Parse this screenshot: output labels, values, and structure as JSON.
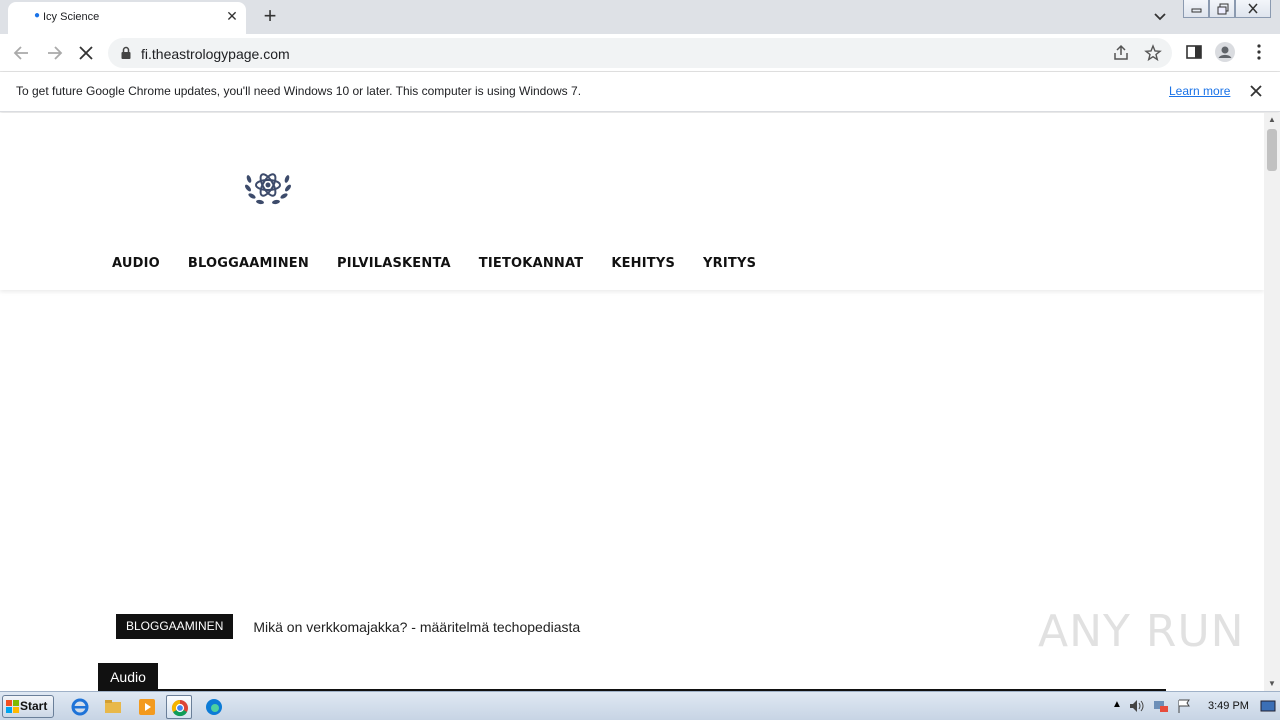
{
  "browser": {
    "tab_title": "Icy Science",
    "url": "fi.theastrologypage.com"
  },
  "infobar": {
    "message": "To get future Google Chrome updates, you'll need Windows 10 or later. This computer is using Windows 7.",
    "link": "Learn more"
  },
  "site": {
    "nav": [
      "AUDIO",
      "BLOGGAAMINEN",
      "PILVILASKENTA",
      "TIETOKANNAT",
      "KEHITYS",
      "YRITYS"
    ],
    "ticker_category": "BLOGGAAMINEN",
    "ticker_headline": "Mikä on verkkomajakka? - määritelmä techopediasta",
    "section_tag": "Audio"
  },
  "watermark": "ANY RUN",
  "taskbar": {
    "start_label": "Start",
    "clock": "3:49 PM"
  },
  "colors": {
    "tabstrip": "#dee1e6",
    "link": "#1a73e8",
    "logo": "#3d4b6b"
  }
}
